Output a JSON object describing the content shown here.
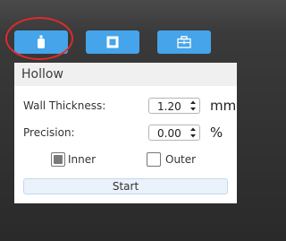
{
  "toolbar": {
    "buttons": [
      {
        "icon": "bottle-icon",
        "active": true
      },
      {
        "icon": "square-frame-icon"
      },
      {
        "icon": "kit-box-icon"
      }
    ],
    "accent": "#45a4ea",
    "highlight_color": "#e02a2a"
  },
  "panel": {
    "title": "Hollow",
    "wall_thickness": {
      "label": "Wall Thickness:",
      "value": "1.20",
      "unit": "mm"
    },
    "precision": {
      "label": "Precision:",
      "value": "0.00",
      "unit": "%"
    },
    "inner": {
      "label": "Inner",
      "checked": true
    },
    "outer": {
      "label": "Outer",
      "checked": false
    },
    "start_label": "Start"
  }
}
